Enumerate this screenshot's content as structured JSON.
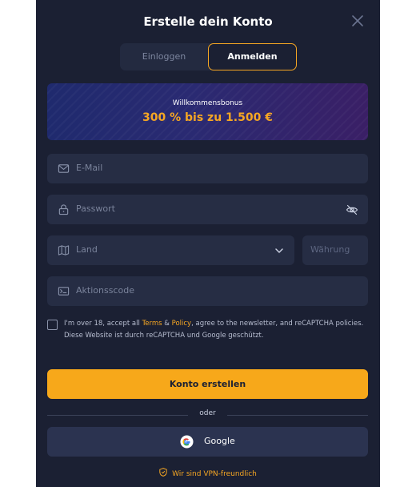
{
  "dialog": {
    "title": "Erstelle dein Konto"
  },
  "tabs": [
    {
      "label": "Einloggen",
      "active": false
    },
    {
      "label": "Anmelden",
      "active": true
    }
  ],
  "bonus": {
    "label": "Willkommensbonus",
    "amount": "300 % bis zu 1.500 €"
  },
  "form": {
    "email_placeholder": "E-Mail",
    "password_placeholder": "Passwort",
    "country_placeholder": "Land",
    "currency_placeholder": "Währung",
    "promo_placeholder": "Aktionsscode"
  },
  "consent": {
    "text_before": "I'm over 18, accept all ",
    "terms": "Terms",
    "amp": " & ",
    "policy": "Policy",
    "text_after": ", agree to the newsletter, and reCAPTCHA policies.",
    "recaptcha_note": "Diese Website ist durch reCAPTCHA und Google geschützt."
  },
  "actions": {
    "create_label": "Konto erstellen",
    "divider_label": "oder",
    "google_label": "Google"
  },
  "footer": {
    "vpn_label": "Wir sind VPN-freundlich"
  },
  "colors": {
    "accent": "#f7a81a",
    "background": "#1b2033",
    "field": "#262d44"
  },
  "icons": [
    "close-icon",
    "mail-icon",
    "lock-icon",
    "eye-off-icon",
    "map-icon",
    "chevron-down-icon",
    "promo-code-icon",
    "google-icon",
    "shield-icon"
  ]
}
